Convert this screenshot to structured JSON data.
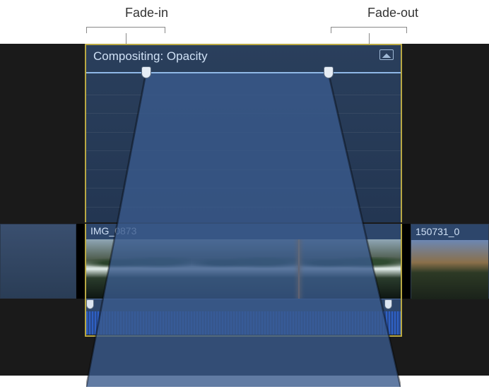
{
  "callouts": {
    "fade_in": "Fade-in",
    "fade_out": "Fade-out"
  },
  "animation_panel": {
    "title": "Compositing: Opacity",
    "fade_in_handle_pct": 19,
    "fade_out_handle_pct": 77
  },
  "clips": {
    "main_label": "IMG_0873",
    "right_label": "150731_0",
    "fade_in_audio_pct": 0,
    "fade_out_audio_pct": 96,
    "playhead_pct": 67
  },
  "colors": {
    "selection_border": "#b9a843",
    "panel_bg_top": "#2a3f5c",
    "control_line": "#8fb8e6"
  }
}
